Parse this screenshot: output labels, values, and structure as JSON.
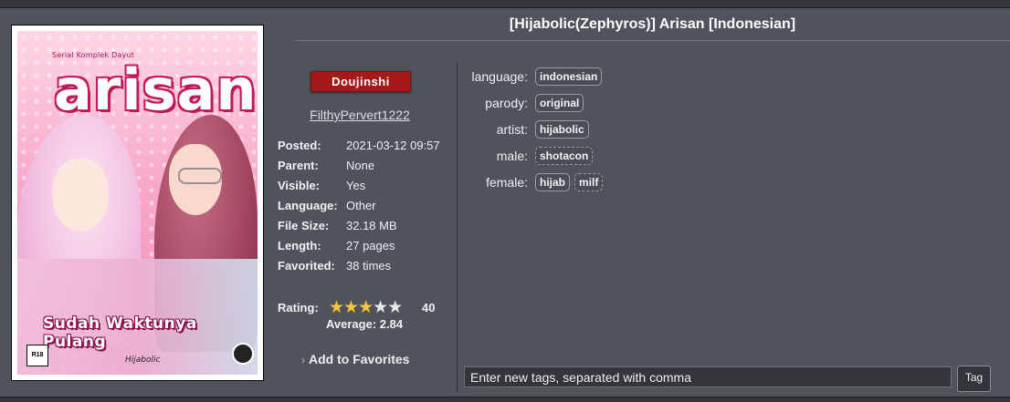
{
  "title": "[Hijabolic(Zephyros)] Arisan [Indonesian]",
  "cover": {
    "series_text": "Serial Komplek Dayut",
    "logo_text": "arisan",
    "subtitle_text": "Sudah Waktunya Pulang",
    "rating_badge": "R18",
    "artist_signature": "Hijabolic"
  },
  "category": "Doujinshi",
  "category_color": "#a41a1a",
  "uploader": "FilthyPervert1222",
  "details": [
    {
      "key": "Posted:",
      "value": "2021-03-12 09:57"
    },
    {
      "key": "Parent:",
      "value": "None"
    },
    {
      "key": "Visible:",
      "value": "Yes"
    },
    {
      "key": "Language:",
      "value": "Other"
    },
    {
      "key": "File Size:",
      "value": "32.18 MB"
    },
    {
      "key": "Length:",
      "value": "27 pages"
    },
    {
      "key": "Favorited:",
      "value": "38 times"
    }
  ],
  "rating": {
    "label": "Rating:",
    "stars": 3,
    "max_stars": 5,
    "count": "40",
    "average": "Average: 2.84"
  },
  "favorites_link": "Add to Favorites",
  "tags": [
    {
      "namespace": "language:",
      "tags": [
        {
          "name": "indonesian",
          "dashed": false
        }
      ]
    },
    {
      "namespace": "parody:",
      "tags": [
        {
          "name": "original",
          "dashed": false
        }
      ]
    },
    {
      "namespace": "artist:",
      "tags": [
        {
          "name": "hijabolic",
          "dashed": false
        }
      ]
    },
    {
      "namespace": "male:",
      "tags": [
        {
          "name": "shotacon",
          "dashed": true
        }
      ]
    },
    {
      "namespace": "female:",
      "tags": [
        {
          "name": "hijab",
          "dashed": false
        },
        {
          "name": "milf",
          "dashed": true
        }
      ]
    }
  ],
  "new_tag_input": {
    "placeholder": "Enter new tags, separated with comma",
    "value": ""
  },
  "tag_button": "Tag"
}
